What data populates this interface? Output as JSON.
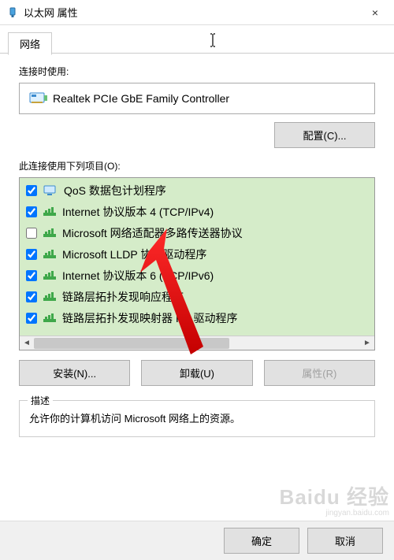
{
  "window": {
    "title": "以太网 属性",
    "close_icon": "×"
  },
  "tabs": {
    "network": "网络"
  },
  "section": {
    "connect_using_label": "连接时使用:",
    "adapter_name": "Realtek PCIe GbE Family Controller",
    "configure_button": "配置(C)...",
    "items_label": "此连接使用下列项目(O):"
  },
  "items": [
    {
      "checked": true,
      "icon": "monitor",
      "label": "QoS 数据包计划程序"
    },
    {
      "checked": true,
      "icon": "proto",
      "label": "Internet 协议版本 4 (TCP/IPv4)"
    },
    {
      "checked": false,
      "icon": "proto",
      "label": "Microsoft 网络适配器多路传送器协议"
    },
    {
      "checked": true,
      "icon": "proto",
      "label": "Microsoft LLDP 协议驱动程序"
    },
    {
      "checked": true,
      "icon": "proto",
      "label": "Internet 协议版本 6 (TCP/IPv6)"
    },
    {
      "checked": true,
      "icon": "proto",
      "label": "链路层拓扑发现响应程序"
    },
    {
      "checked": true,
      "icon": "proto",
      "label": "链路层拓扑发现映射器 I/O 驱动程序"
    }
  ],
  "buttons": {
    "install": "安装(N)...",
    "uninstall": "卸载(U)",
    "properties": "属性(R)"
  },
  "description": {
    "legend": "描述",
    "text": "允许你的计算机访问 Microsoft 网络上的资源。"
  },
  "dialog_buttons": {
    "ok": "确定",
    "cancel": "取消"
  },
  "watermark": {
    "big": "Baidu 经验",
    "small": "jingyan.baidu.com"
  }
}
